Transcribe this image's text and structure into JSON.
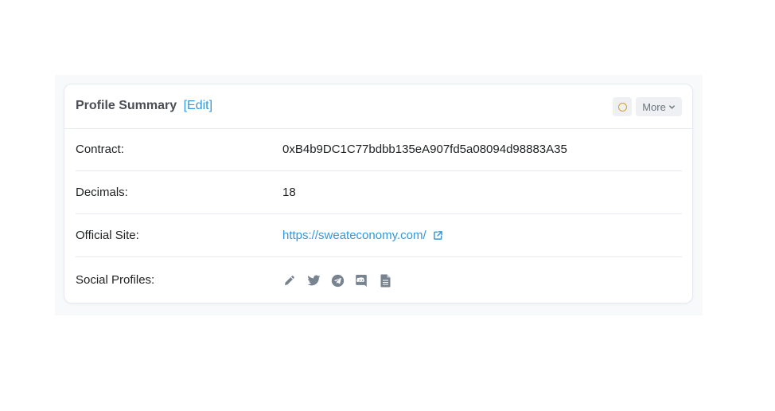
{
  "header": {
    "title": "Profile Summary",
    "edit_label": "[Edit]",
    "more_label": "More",
    "status_color": "#d4a21c"
  },
  "rows": {
    "contract": {
      "label": "Contract:",
      "value": "0xB4b9DC1C77bdbb135eA907fd5a08094d98883A35"
    },
    "decimals": {
      "label": "Decimals:",
      "value": "18"
    },
    "site": {
      "label": "Official Site:",
      "value": "https://sweateconomy.com/"
    },
    "social": {
      "label": "Social Profiles:",
      "icons": [
        "pencil-icon",
        "twitter-icon",
        "telegram-icon",
        "discord-icon",
        "document-icon"
      ]
    }
  },
  "colors": {
    "link": "#3498db",
    "text": "#1e2022",
    "icon": "#77838f",
    "border": "#e7eaf3"
  }
}
